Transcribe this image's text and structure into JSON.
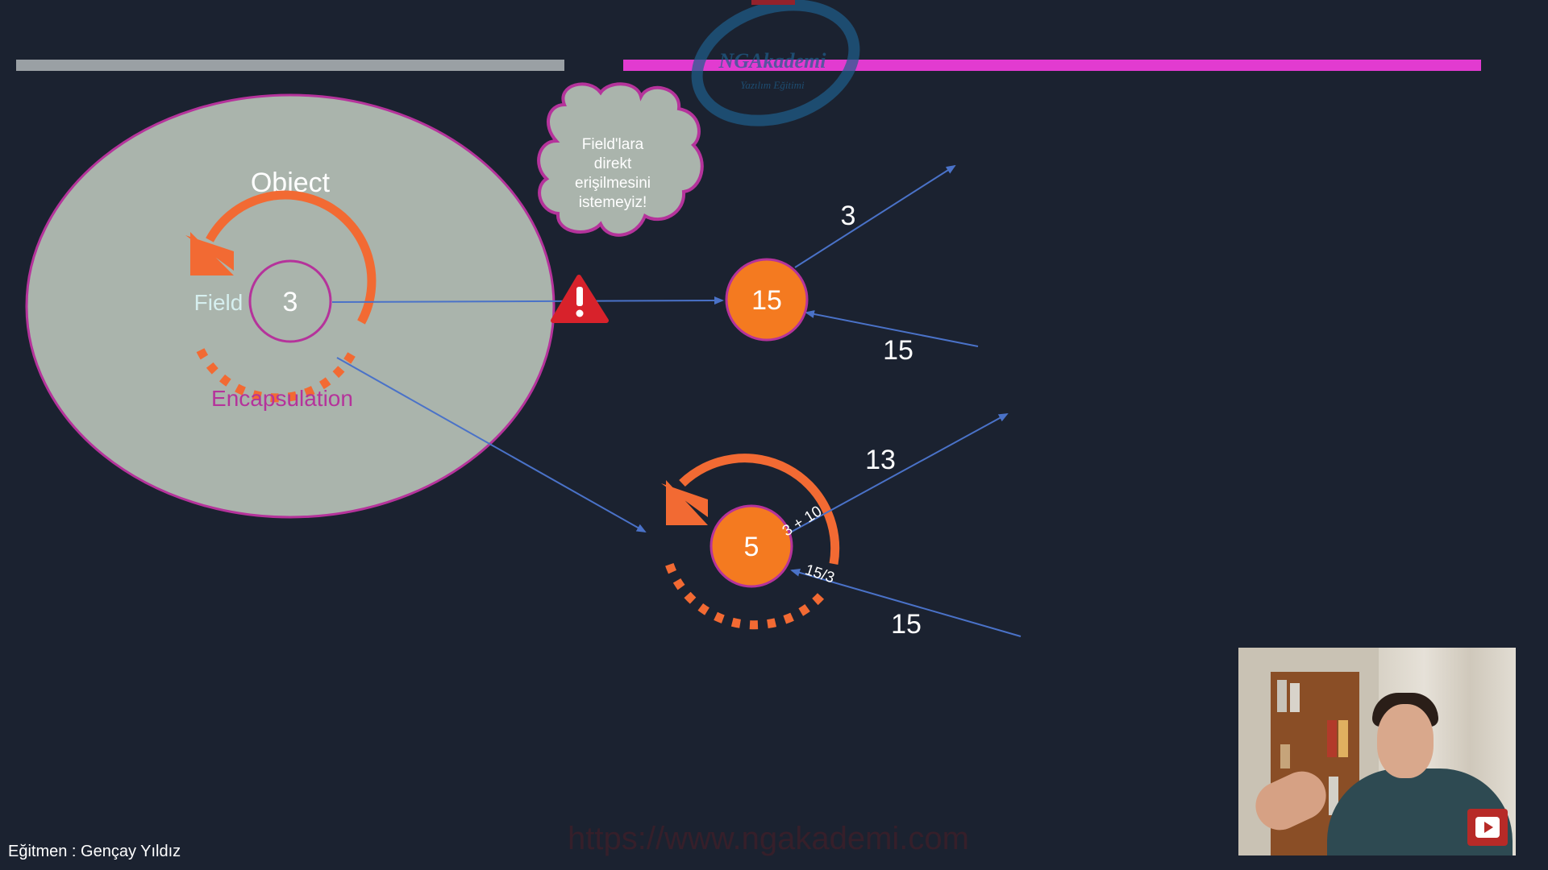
{
  "diagram": {
    "object_label": "Object",
    "field_label": "Field",
    "field_value": "3",
    "encapsulation_label": "Encapsulation",
    "cloud_lines": [
      "Field'lara",
      "direkt",
      "erişilmesini",
      "istemeyiz!"
    ],
    "top_node_value": "15",
    "top_out_label": "3",
    "top_in_label": "15",
    "bottom_node_value": "5",
    "bottom_out_label": "13",
    "bottom_in_label": "15",
    "bottom_out_expr": "3 + 10",
    "bottom_in_expr": "15/3"
  },
  "logo": {
    "text": "NGAkademi",
    "subtitle": "Yazılım Eğitimi"
  },
  "watermark_url": "https://www.ngakademi.com",
  "trainer_caption": "Eğitmen : Gençay Yıldız",
  "colors": {
    "background": "#1b2230",
    "object_fill": "#aab4ac",
    "magenta": "#b5339b",
    "orange": "#f47a20",
    "orange_arrow": "#f26a33",
    "blue_line": "#4a72c8",
    "pink_bar": "#e23bd0",
    "gray_bar": "#9aa0a4",
    "warning_red": "#d8222b"
  }
}
